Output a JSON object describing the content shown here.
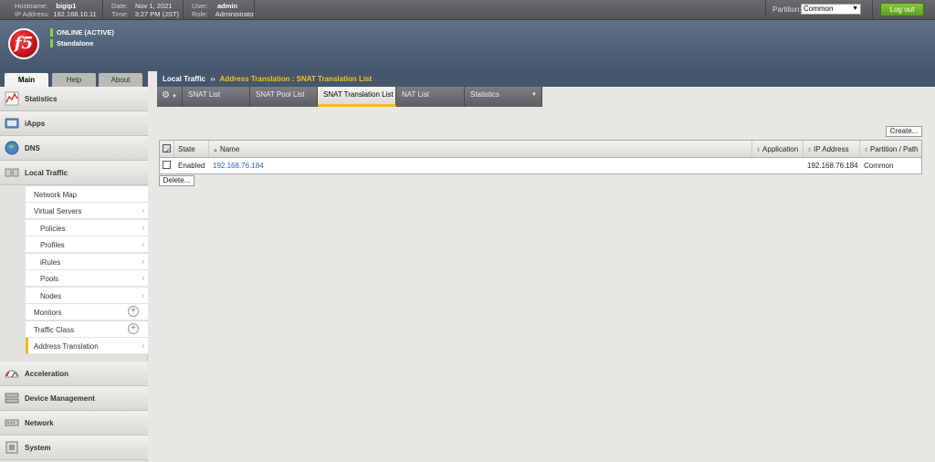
{
  "topbar": {
    "hostname_label": "Hostname:",
    "hostname": "bigip1",
    "ip_label": "IP Address:",
    "ip": "192.168.10.11",
    "date_label": "Date:",
    "date": "Nov 1, 2021",
    "time_label": "Time:",
    "time": "3:27 PM (JST)",
    "user_label": "User:",
    "user": "admin",
    "role_label": "Role:",
    "role": "Administrator",
    "partition_label": "Partition:",
    "partition_value": "Common",
    "logout_label": "Log out"
  },
  "banner": {
    "logo_text": "f5",
    "status": "ONLINE (ACTIVE)",
    "mode": "Standalone"
  },
  "left_tabs": [
    "Main",
    "Help",
    "About"
  ],
  "sidebar": {
    "sections_top": [
      "Statistics",
      "iApps",
      "DNS",
      "Local Traffic"
    ],
    "local_traffic_items": [
      {
        "label": "Network Map",
        "indent": false,
        "marker": ""
      },
      {
        "label": "Virtual Servers",
        "indent": false,
        "marker": "arrow"
      },
      {
        "label": "Policies",
        "indent": true,
        "marker": "arrow"
      },
      {
        "label": "Profiles",
        "indent": true,
        "marker": "arrow"
      },
      {
        "label": "iRules",
        "indent": true,
        "marker": "arrow"
      },
      {
        "label": "Pools",
        "indent": true,
        "marker": "arrow"
      },
      {
        "label": "Nodes",
        "indent": true,
        "marker": "arrow"
      },
      {
        "label": "Monitors",
        "indent": false,
        "marker": "plus"
      },
      {
        "label": "Traffic Class",
        "indent": false,
        "marker": "plus"
      },
      {
        "label": "Address Translation",
        "indent": false,
        "marker": "arrow",
        "active": true
      }
    ],
    "sections_bottom": [
      "Acceleration",
      "Device Management",
      "Network",
      "System"
    ]
  },
  "breadcrumb": {
    "root": "Local Traffic",
    "sep": "››",
    "current": "Address Translation : SNAT Translation List"
  },
  "tabs": [
    "SNAT List",
    "SNAT Pool List",
    "SNAT Translation List",
    "NAT List",
    "Statistics"
  ],
  "active_tab": "SNAT Translation List",
  "create_label": "Create...",
  "delete_label": "Delete...",
  "table": {
    "headers": [
      "State",
      "Name",
      "Application",
      "IP Address",
      "Partition / Path"
    ],
    "rows": [
      {
        "state": "Enabled",
        "name": "192.168.76.184",
        "application": "",
        "ip": "192.168.76.184",
        "partition": "Common"
      }
    ]
  },
  "colors": {
    "accent": "#f6b91e",
    "link": "#2b63b0",
    "banner": "#45566d",
    "logout": "#6fb02b"
  }
}
